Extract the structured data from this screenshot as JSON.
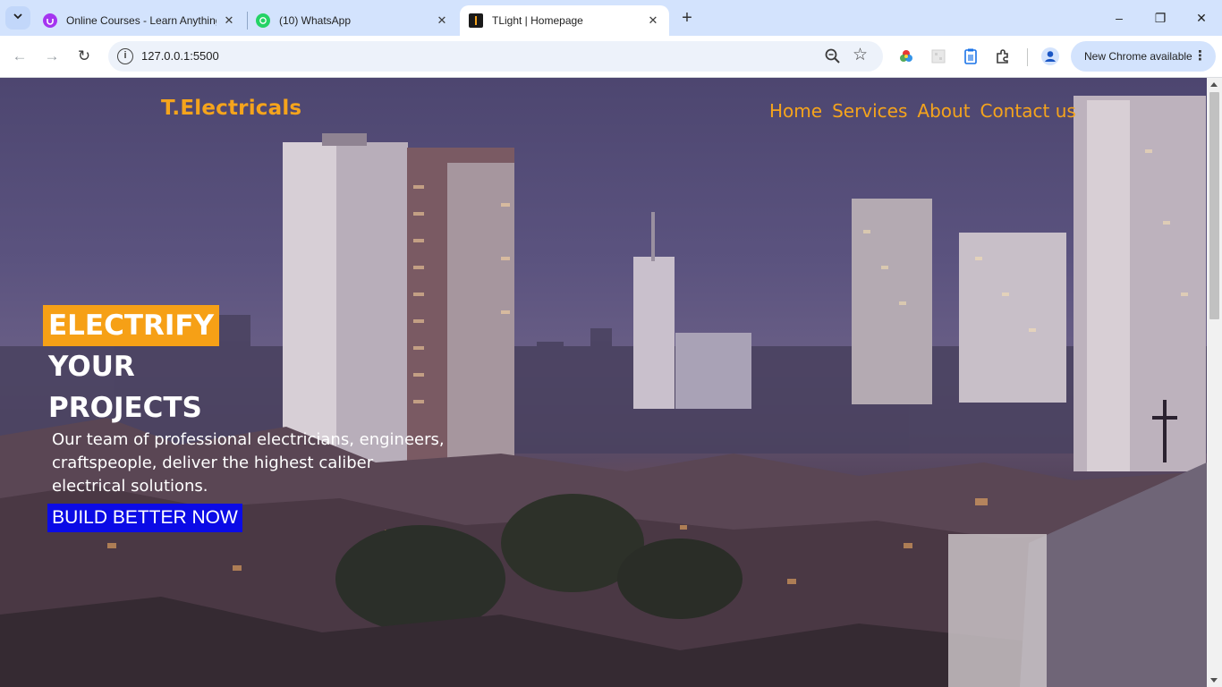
{
  "browser": {
    "tabs": [
      {
        "title": "Online Courses - Learn Anything",
        "favicon": "udemy-icon",
        "active": false
      },
      {
        "title": "(10) WhatsApp",
        "favicon": "whatsapp-icon",
        "active": false
      },
      {
        "title": "TLight | Homepage",
        "favicon": "site-icon",
        "active": true
      }
    ],
    "url": "127.0.0.1:5500",
    "update_label": "New Chrome available",
    "new_tab_glyph": "+",
    "window_controls": {
      "minimize": "–",
      "restore": "❐",
      "close": "✕"
    },
    "nav_glyphs": {
      "back": "←",
      "forward": "→",
      "reload": "↻"
    },
    "tab_close_glyph": "✕",
    "info_glyph": "i",
    "star_glyph": "☆",
    "menu_glyph": "⋮"
  },
  "page": {
    "brand": "T.Electricals",
    "nav": [
      "Home",
      "Services",
      "About",
      "Contact us"
    ],
    "hero": {
      "line1": "ELECTRIFY",
      "line2": "YOUR",
      "line3": "PROJECTS",
      "description": "Our team of professional electricians, engineers, craftspeople, deliver the highest caliber electrical solutions.",
      "cta": "BUILD BETTER NOW"
    }
  },
  "colors": {
    "accent": "#f5a41c",
    "cta_bg": "#0b0be6",
    "text": "#ffffff"
  }
}
